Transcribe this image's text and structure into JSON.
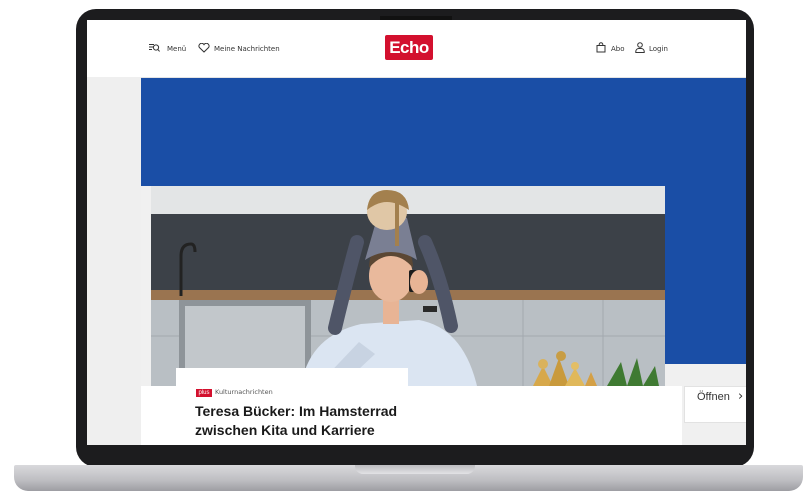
{
  "header": {
    "menu_label": "Menü",
    "favorites_label": "Meine Nachrichten",
    "logo_text": "Echo",
    "subscription_label": "Abo",
    "login_label": "Login"
  },
  "article": {
    "badge": "plus",
    "category": "Kulturnachrichten",
    "headline_line1": "Teresa Bücker: Im Hamsterrad",
    "headline_line2": "zwischen Kita und Karriere"
  },
  "side_button": {
    "label": "Öffnen"
  },
  "colors": {
    "brand_red": "#d3102e",
    "ad_blue": "#1a4ea6"
  },
  "icons": [
    "menu-search-icon",
    "heart-icon",
    "shopping-bag-icon",
    "user-icon",
    "chevron-right-icon"
  ]
}
